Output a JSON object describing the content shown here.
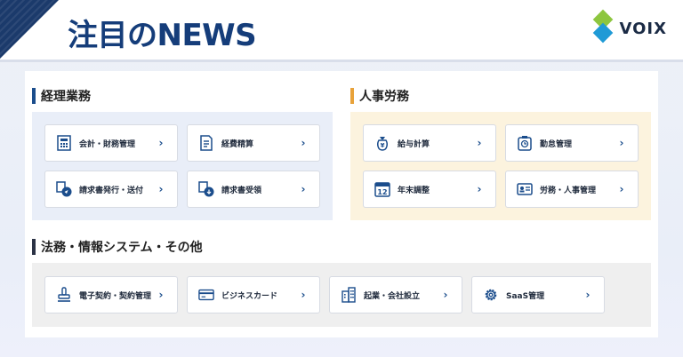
{
  "header": {
    "title": "注目のNEWS",
    "logo_text": "VOIX"
  },
  "colors": {
    "accent_blue": "#1b4d8c",
    "accent_orange": "#e8a23a",
    "dark": "#2b3245"
  },
  "sections": [
    {
      "title": "経理業務",
      "cards": [
        {
          "label": "会計・財務管理",
          "icon": "calculator-icon"
        },
        {
          "label": "経費精算",
          "icon": "receipt-icon"
        },
        {
          "label": "請求書発行・送付",
          "icon": "invoice-send-icon"
        },
        {
          "label": "請求書受領",
          "icon": "invoice-receive-icon"
        }
      ]
    },
    {
      "title": "人事労務",
      "cards": [
        {
          "label": "給与計算",
          "icon": "payroll-bag-icon"
        },
        {
          "label": "勤怠管理",
          "icon": "clock-icon"
        },
        {
          "label": "年末調整",
          "icon": "calendar-12-icon"
        },
        {
          "label": "労務・人事管理",
          "icon": "id-card-icon"
        }
      ]
    },
    {
      "title": "法務・情報システム・その他",
      "cards": [
        {
          "label": "電子契約・契約管理",
          "icon": "stamp-icon"
        },
        {
          "label": "ビジネスカード",
          "icon": "credit-card-icon"
        },
        {
          "label": "起業・会社設立",
          "icon": "building-icon"
        },
        {
          "label": "SaaS管理",
          "icon": "gear-icon"
        }
      ]
    }
  ]
}
